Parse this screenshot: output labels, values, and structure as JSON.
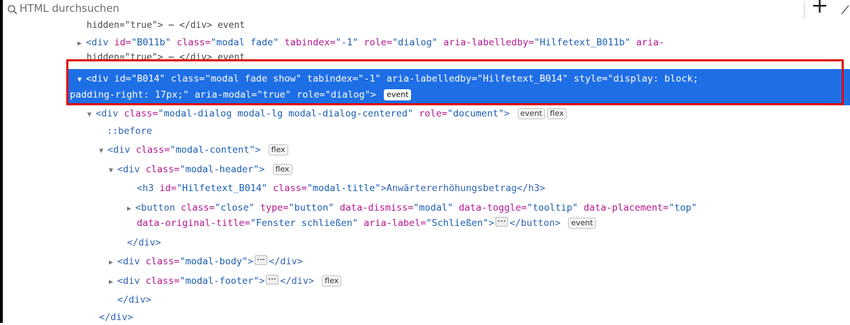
{
  "search": {
    "placeholder": "HTML durchsuchen"
  },
  "toolbar": {
    "add_icon": "plus-icon",
    "picker_icon": "eyedropper-icon"
  },
  "tree": {
    "partial_above_1": "hidden=\"true\"> ⋯ </div> event",
    "row_b011b": {
      "open": "<div",
      "a1n": "id=",
      "a1v": "\"B011b\"",
      "a2n": "class=",
      "a2v": "\"modal fade\"",
      "a3n": "tabindex=",
      "a3v": "\"-1\"",
      "a4n": "role=",
      "a4v": "\"dialog\"",
      "a5n": "aria-labelledby=",
      "a5v": "\"Hilfetext_B011b\"",
      "a6n": "aria-"
    },
    "partial_above_2": "hidden=\"true\"> ⋯ </div> event",
    "row_b014": {
      "line1": "<div id=\"B014\" class=\"modal fade show\" tabindex=\"-1\" aria-labelledby=\"Hilfetext_B014\" style=\"display: block;",
      "line2": "padding-right: 17px;\" aria-modal=\"true\" role=\"dialog\">",
      "badge": "event"
    },
    "row_dialog": {
      "open": "<div",
      "a1n": "class=",
      "a1v": "\"modal-dialog modal-lg modal-dialog-centered\"",
      "a2n": "role=",
      "a2v": "\"document\"",
      "close": ">",
      "badge1": "event",
      "badge2": "flex"
    },
    "row_before": "::before",
    "row_content": {
      "open": "<div",
      "an": "class=",
      "av": "\"modal-content\"",
      "close": ">",
      "badge": "flex"
    },
    "row_header": {
      "open": "<div",
      "an": "class=",
      "av": "\"modal-header\"",
      "close": ">",
      "badge": "flex"
    },
    "row_h3": {
      "open": "<h3",
      "a1n": "id=",
      "a1v": "\"Hilfetext_B014\"",
      "a2n": "class=",
      "a2v": "\"modal-title\"",
      "text": ">Anwärtererhöhungsbetrag</h3>"
    },
    "row_button": {
      "open": "<button",
      "a1n": "class=",
      "a1v": "\"close\"",
      "a2n": "type=",
      "a2v": "\"button\"",
      "a3n": "data-dismiss=",
      "a3v": "\"modal\"",
      "a4n": "data-toggle=",
      "a4v": "\"tooltip\"",
      "a5n": "data-placement=",
      "a5v": "\"top\"",
      "a6n": "data-original-title=",
      "a6v": "\"Fenster schließen\"",
      "a7n": "aria-label=",
      "a7v": "\"Schließen\"",
      "close_open": ">",
      "close_tag": "</button>",
      "badge": "event"
    },
    "row_header_close": "</div>",
    "row_body": {
      "open": "<div",
      "an": "class=",
      "av": "\"modal-body\"",
      "close_open": ">",
      "close_tag": "</div>"
    },
    "row_footer": {
      "open": "<div",
      "an": "class=",
      "av": "\"modal-footer\"",
      "close_open": ">",
      "close_tag": "</div>",
      "badge": "flex"
    },
    "row_content_close": "</div>",
    "row_dialog_close": "</div>"
  },
  "colors": {
    "selection": "#1e6ee6",
    "highlight_border": "#e00000",
    "tag": "#2f64b4",
    "attr_name": "#b5178f",
    "attr_value": "#1a5fb4"
  }
}
